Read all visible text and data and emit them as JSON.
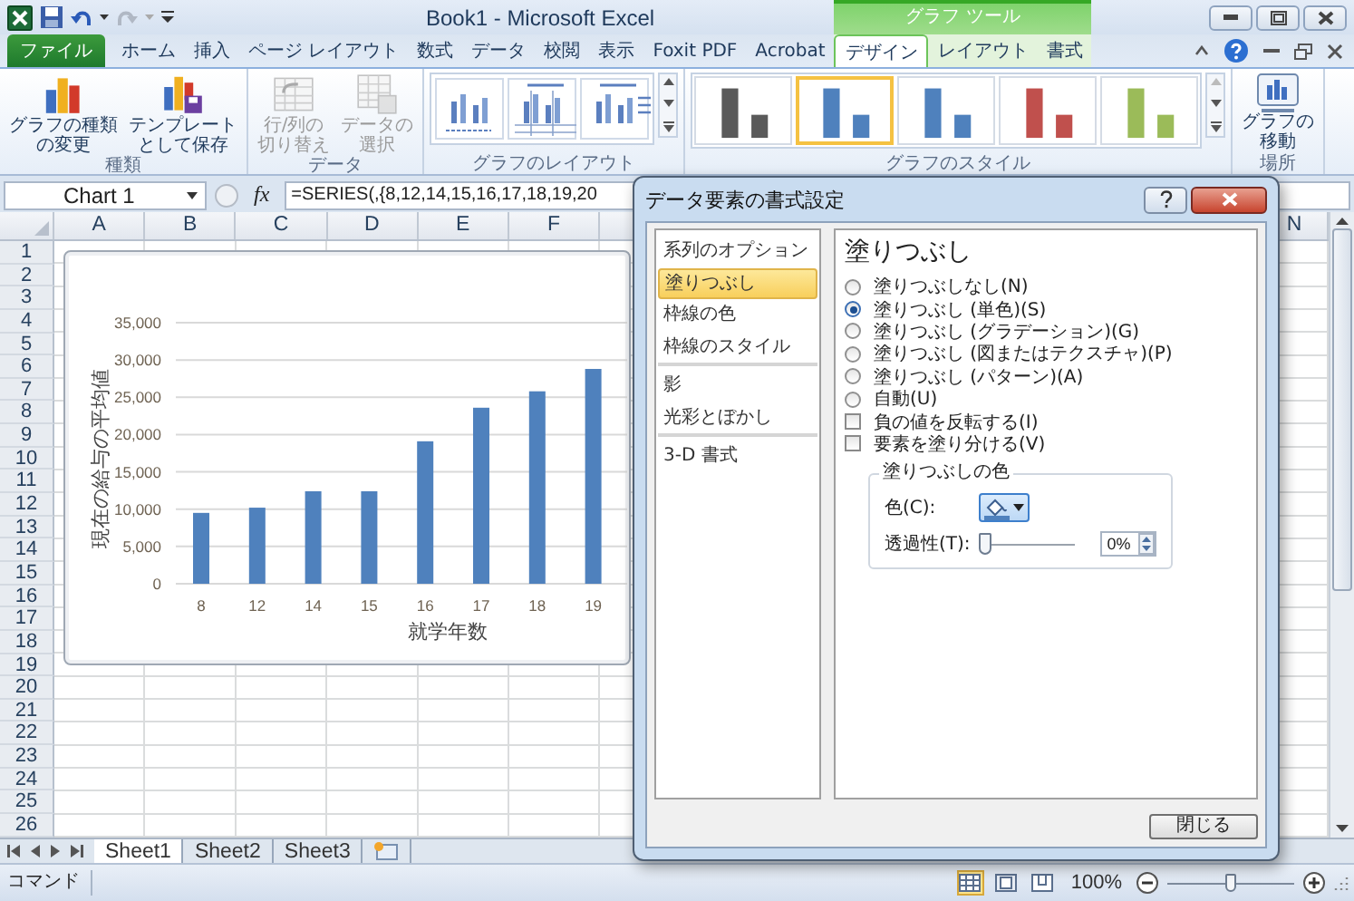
{
  "title_bar": {
    "title": "Book1 - Microsoft Excel",
    "context_tab_group": "グラフ ツール"
  },
  "ribbon_tabs": [
    {
      "label": "ファイル",
      "kind": "file",
      "selected": false
    },
    {
      "label": "ホーム",
      "kind": "normal",
      "selected": false
    },
    {
      "label": "挿入",
      "kind": "normal",
      "selected": false
    },
    {
      "label": "ページ レイアウト",
      "kind": "normal",
      "selected": false
    },
    {
      "label": "数式",
      "kind": "normal",
      "selected": false
    },
    {
      "label": "データ",
      "kind": "normal",
      "selected": false
    },
    {
      "label": "校閲",
      "kind": "normal",
      "selected": false
    },
    {
      "label": "表示",
      "kind": "normal",
      "selected": false
    },
    {
      "label": "Foxit PDF",
      "kind": "normal",
      "selected": false
    },
    {
      "label": "Acrobat",
      "kind": "normal",
      "selected": false
    },
    {
      "label": "デザイン",
      "kind": "context",
      "selected": true
    },
    {
      "label": "レイアウト",
      "kind": "context",
      "selected": false
    },
    {
      "label": "書式",
      "kind": "context",
      "selected": false
    }
  ],
  "ribbon": {
    "groups": [
      {
        "kind": "buttons",
        "label": "種類",
        "buttons": [
          {
            "kind": "change-type",
            "label": "グラフの種類の変更",
            "disabled": false
          },
          {
            "kind": "save-template",
            "label": "テンプレートとして保存",
            "disabled": false
          }
        ]
      },
      {
        "kind": "buttons",
        "label": "データ",
        "buttons": [
          {
            "kind": "switch-row-column",
            "label": "行/列の切り替え",
            "disabled": true
          },
          {
            "kind": "select-data",
            "label": "データの選択",
            "disabled": true
          }
        ]
      },
      {
        "kind": "layout-gallery",
        "label": "グラフのレイアウト",
        "items": [
          {
            "kind": "layout-a"
          },
          {
            "kind": "layout-b"
          },
          {
            "kind": "layout-c"
          }
        ]
      },
      {
        "kind": "style-gallery",
        "label": "グラフのスタイル",
        "items": [
          {
            "color": "#5a5a5a",
            "selected": false
          },
          {
            "color": "#4f81bd",
            "selected": true
          },
          {
            "color": "#4f81bd",
            "selected": false
          },
          {
            "color": "#c0504d",
            "selected": false
          },
          {
            "color": "#9bbb59",
            "selected": false
          }
        ]
      },
      {
        "kind": "buttons",
        "label": "場所",
        "buttons": [
          {
            "kind": "move-chart",
            "label": "グラフの移動",
            "disabled": false
          }
        ]
      }
    ]
  },
  "formula_bar": {
    "name_box": "Chart 1",
    "fx_label": "fx",
    "formula": "=SERIES(,{8,12,14,15,16,17,18,19,20"
  },
  "sheet": {
    "columns": [
      "A",
      "B",
      "C",
      "D",
      "E",
      "F"
    ],
    "columns_right": [
      "N"
    ],
    "rows": [
      "1",
      "2",
      "3",
      "4",
      "5",
      "6",
      "7",
      "8",
      "9",
      "10",
      "11",
      "12",
      "13",
      "14",
      "15",
      "16",
      "17",
      "18",
      "19",
      "20",
      "21",
      "22",
      "23",
      "24",
      "25",
      "26"
    ],
    "chart": {
      "chart_data": {
        "type": "bar",
        "xlabel": "就学年数",
        "ylabel": "現在の給与の平均値",
        "categories": [
          "8",
          "12",
          "14",
          "15",
          "16",
          "17",
          "18",
          "19"
        ],
        "series": [
          {
            "color": "#4f81bd",
            "values": [
              9500,
              10200,
              12400,
              12400,
              19100,
              23600,
              25800,
              28800
            ]
          }
        ],
        "ylim": [
          0,
          35000
        ],
        "grid": true,
        "yticks": [
          {
            "value": 0,
            "label": "0"
          },
          {
            "value": 5000,
            "label": "5,000"
          },
          {
            "value": 10000,
            "label": "10,000"
          },
          {
            "value": 15000,
            "label": "15,000"
          },
          {
            "value": 20000,
            "label": "20,000"
          },
          {
            "value": 25000,
            "label": "25,000"
          },
          {
            "value": 30000,
            "label": "30,000"
          },
          {
            "value": 35000,
            "label": "35,000"
          }
        ]
      }
    }
  },
  "sheet_tabs": [
    {
      "label": "Sheet1",
      "selected": true
    },
    {
      "label": "Sheet2",
      "selected": false
    },
    {
      "label": "Sheet3",
      "selected": false
    }
  ],
  "status_bar": {
    "mode": "コマンド",
    "views": [
      {
        "kind": "normal",
        "selected": true
      },
      {
        "kind": "page-layout",
        "selected": false
      },
      {
        "kind": "page-break",
        "selected": false
      }
    ],
    "zoom": "100%",
    "zoom_slider": {
      "level": 0.5
    }
  },
  "dialog": {
    "title": "データ要素の書式設定",
    "nav": [
      {
        "label": "系列のオプション",
        "selected": false,
        "divider_after": false
      },
      {
        "label": "塗りつぶし",
        "selected": true,
        "divider_after": false
      },
      {
        "label": "枠線の色",
        "selected": false,
        "divider_after": false
      },
      {
        "label": "枠線のスタイル",
        "selected": false,
        "divider_after": true
      },
      {
        "label": "影",
        "selected": false,
        "divider_after": false
      },
      {
        "label": "光彩とぼかし",
        "selected": false,
        "divider_after": true
      },
      {
        "label": "3-D 書式",
        "selected": false,
        "divider_after": false
      }
    ],
    "heading": "塗りつぶし",
    "fill_options": [
      {
        "label": "塗りつぶしなし(N)",
        "selected": false
      },
      {
        "label": "塗りつぶし (単色)(S)",
        "selected": true
      },
      {
        "label": "塗りつぶし (グラデーション)(G)",
        "selected": false
      },
      {
        "label": "塗りつぶし (図またはテクスチャ)(P)",
        "selected": false
      },
      {
        "label": "塗りつぶし (パターン)(A)",
        "selected": false
      },
      {
        "label": "自動(U)",
        "selected": false
      }
    ],
    "checkboxes": [
      {
        "label": "負の値を反転する(I)",
        "checked": false
      },
      {
        "label": "要素を塗り分ける(V)",
        "checked": false
      }
    ],
    "color_group": {
      "title": "塗りつぶしの色",
      "color_label": "色(C):",
      "color": "#4f81bd",
      "transparency_label": "透過性(T):",
      "transparency": {
        "level": 0
      },
      "transparency_value": "0%"
    },
    "close_button": "閉じる"
  }
}
